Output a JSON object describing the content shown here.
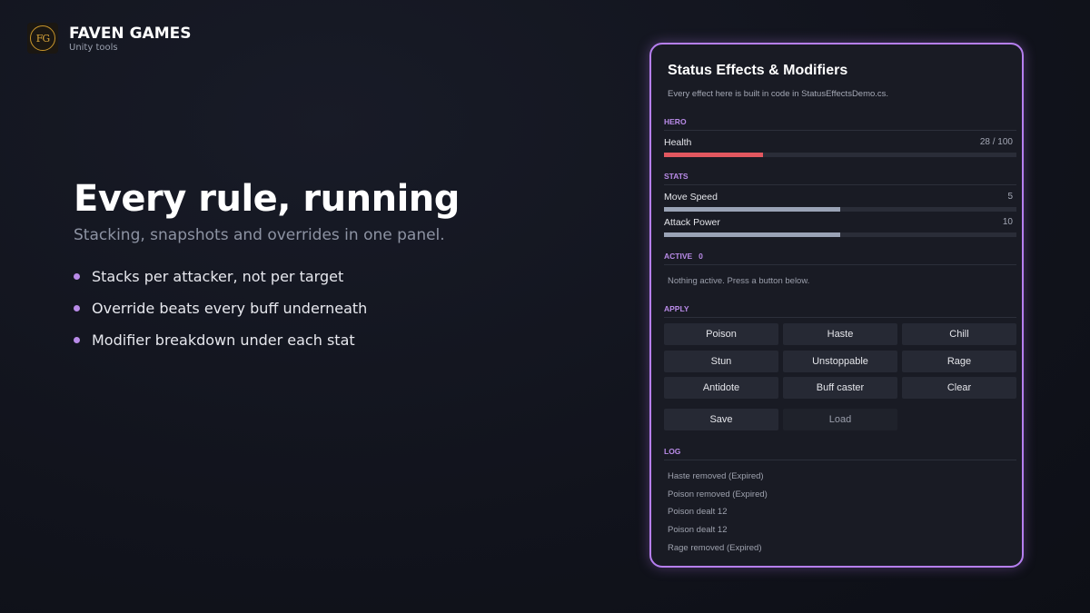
{
  "brand": {
    "logo_text": "FG",
    "name": "FAVEN GAMES",
    "tagline": "Unity tools"
  },
  "pitch": {
    "headline": "Every rule, running",
    "subheadline": "Stacking, snapshots and overrides in one panel.",
    "bullets": [
      "Stacks per attacker, not per target",
      "Override beats every buff underneath",
      "Modifier breakdown under each stat"
    ]
  },
  "panel": {
    "title": "Status Effects & Modifiers",
    "description": "Every effect here is built in code in StatusEffectsDemo.cs.",
    "hero": {
      "section_label": "HERO",
      "health_label": "Health",
      "health_value": "28 / 100",
      "health_fraction": 0.28,
      "health_color": "#e2575f"
    },
    "stats": {
      "section_label": "STATS",
      "items": [
        {
          "label": "Move Speed",
          "value": "5",
          "fraction": 0.5
        },
        {
          "label": "Attack Power",
          "value": "10",
          "fraction": 0.5
        }
      ],
      "bar_color": "#9aa3b6"
    },
    "active": {
      "section_label": "ACTIVE",
      "count": "0",
      "empty_message": "Nothing active. Press a button below."
    },
    "apply": {
      "section_label": "APPLY",
      "buttons": [
        "Poison",
        "Haste",
        "Chill",
        "Stun",
        "Unstoppable",
        "Rage",
        "Antidote",
        "Buff caster",
        "Clear"
      ],
      "save_label": "Save",
      "load_label": "Load"
    },
    "log": {
      "section_label": "LOG",
      "lines": [
        "Haste removed (Expired)",
        "Poison removed (Expired)",
        "Poison dealt 12",
        "Poison dealt 12",
        "Rage removed (Expired)"
      ]
    },
    "accent_color": "#b98be8"
  }
}
